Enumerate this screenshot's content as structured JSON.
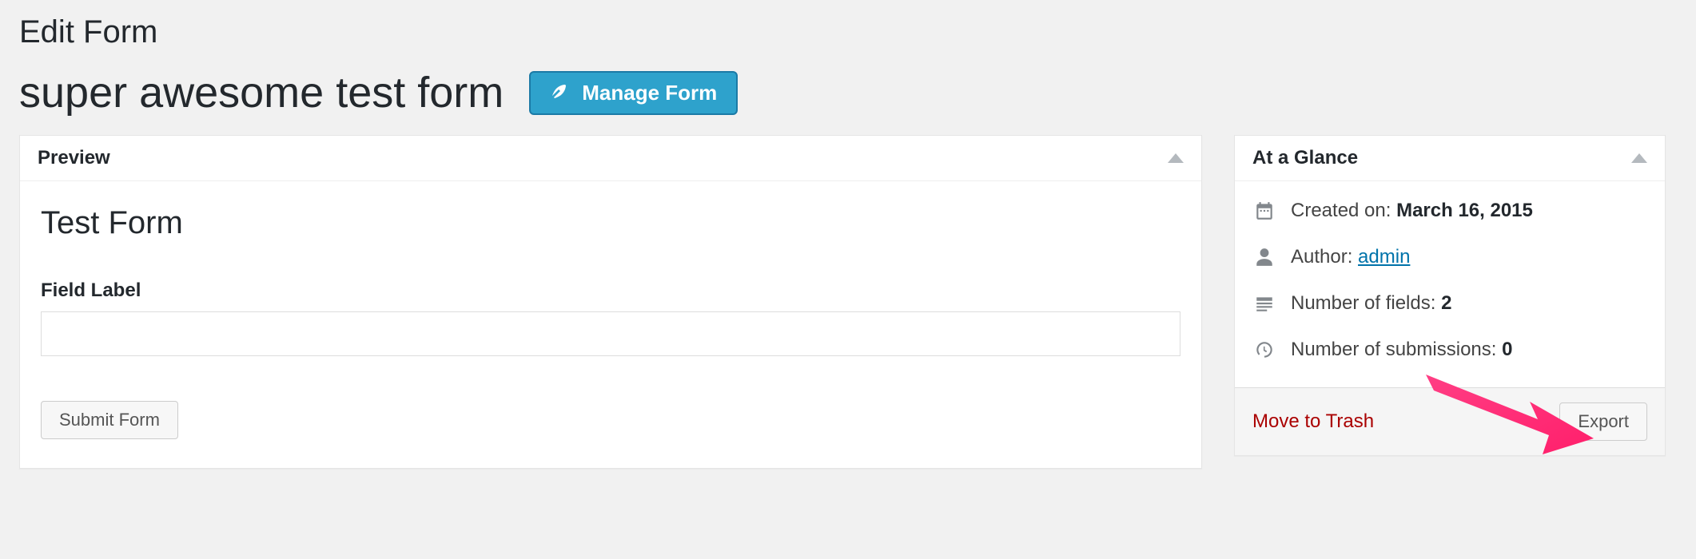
{
  "page_title": "Edit Form",
  "form_title": "super awesome test form",
  "manage_button_label": "Manage Form",
  "preview": {
    "panel_title": "Preview",
    "form_heading": "Test Form",
    "field_label": "Field Label",
    "submit_label": "Submit Form"
  },
  "glance": {
    "panel_title": "At a Glance",
    "created_label": "Created on: ",
    "created_value": "March 16, 2015",
    "author_label": "Author: ",
    "author_value": "admin",
    "fields_label": "Number of fields: ",
    "fields_value": "2",
    "subs_label": "Number of submissions: ",
    "subs_value": "0",
    "trash_label": "Move to Trash",
    "export_label": "Export"
  }
}
